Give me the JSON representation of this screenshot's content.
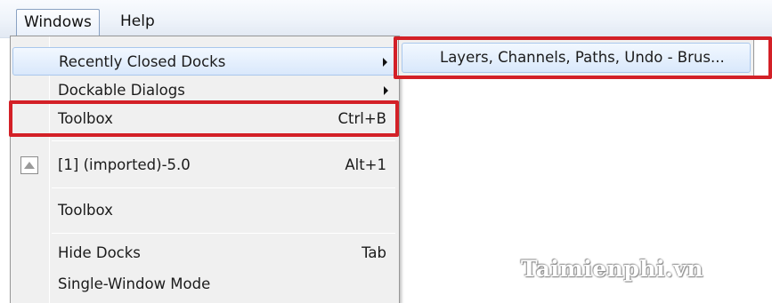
{
  "menubar": {
    "items": [
      {
        "label": "Windows",
        "mnemonic_index": 0,
        "active": true
      },
      {
        "label": "Help",
        "mnemonic_index": 0,
        "active": false
      }
    ]
  },
  "windows_menu": {
    "items": [
      {
        "label": "Recently Closed Docks",
        "accel": "",
        "submenu": true
      },
      {
        "label": "Dockable Dialogs",
        "accel": "",
        "submenu": true
      },
      {
        "label": "Toolbox",
        "accel": "Ctrl+B",
        "submenu": false
      },
      {
        "label": "[1] (imported)-5.0",
        "accel": "Alt+1",
        "submenu": false,
        "icon": "image-thumbnail-icon"
      },
      {
        "label": "Toolbox",
        "accel": "",
        "submenu": false
      },
      {
        "label": "Hide Docks",
        "accel": "Tab",
        "submenu": false
      },
      {
        "label": "Single-Window Mode",
        "accel": "",
        "submenu": false
      }
    ]
  },
  "recently_closed_submenu": {
    "items": [
      {
        "label": "Layers, Channels, Paths, Undo - Brus..."
      }
    ]
  },
  "watermark": "Taimienphi.vn",
  "colors": {
    "highlight_annotation": "#d32027",
    "menu_background": "#f0f0f0",
    "hover_fill": "#d9e8fb"
  }
}
